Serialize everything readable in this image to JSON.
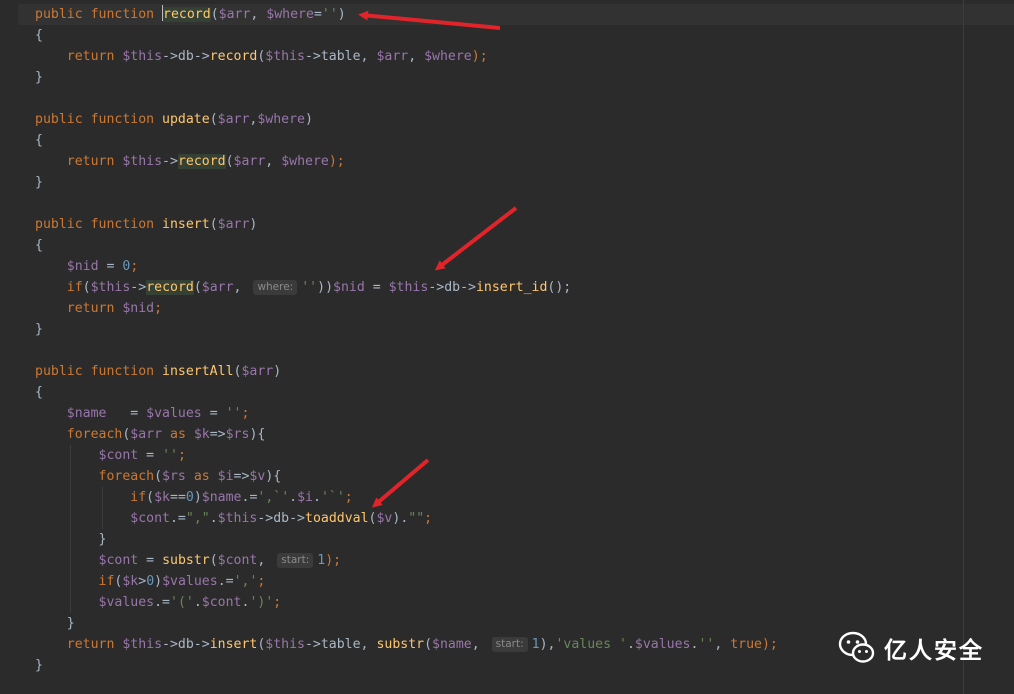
{
  "editor": {
    "lines": [
      [
        {
          "t": "public function ",
          "c": "kw"
        },
        {
          "t": "",
          "c": "caret"
        },
        {
          "t": "record",
          "c": "hl"
        },
        {
          "t": "(",
          "c": "plain"
        },
        {
          "t": "$arr",
          "c": "var"
        },
        {
          "t": ", ",
          "c": "plain"
        },
        {
          "t": "$where",
          "c": "var"
        },
        {
          "t": "=",
          "c": "plain"
        },
        {
          "t": "''",
          "c": "str"
        },
        {
          "t": ")",
          "c": "plain"
        }
      ],
      [
        {
          "t": "{",
          "c": "plain"
        }
      ],
      [
        {
          "t": "    return ",
          "c": "kw"
        },
        {
          "t": "$this",
          "c": "var"
        },
        {
          "t": "->db->",
          "c": "plain"
        },
        {
          "t": "record",
          "c": "fn"
        },
        {
          "t": "(",
          "c": "plain"
        },
        {
          "t": "$this",
          "c": "var"
        },
        {
          "t": "->table, ",
          "c": "plain"
        },
        {
          "t": "$arr",
          "c": "var"
        },
        {
          "t": ", ",
          "c": "plain"
        },
        {
          "t": "$where",
          "c": "var"
        },
        {
          "t": ");",
          "c": "kw"
        }
      ],
      [
        {
          "t": "}",
          "c": "plain"
        }
      ],
      [],
      [
        {
          "t": "public function ",
          "c": "kw"
        },
        {
          "t": "update",
          "c": "fn"
        },
        {
          "t": "(",
          "c": "plain"
        },
        {
          "t": "$arr",
          "c": "var"
        },
        {
          "t": ",",
          "c": "plain"
        },
        {
          "t": "$where",
          "c": "var"
        },
        {
          "t": ")",
          "c": "plain"
        }
      ],
      [
        {
          "t": "{",
          "c": "plain"
        }
      ],
      [
        {
          "t": "    return ",
          "c": "kw"
        },
        {
          "t": "$this",
          "c": "var"
        },
        {
          "t": "->",
          "c": "plain"
        },
        {
          "t": "record",
          "c": "hl"
        },
        {
          "t": "(",
          "c": "plain"
        },
        {
          "t": "$arr",
          "c": "var"
        },
        {
          "t": ", ",
          "c": "plain"
        },
        {
          "t": "$where",
          "c": "var"
        },
        {
          "t": ");",
          "c": "kw"
        }
      ],
      [
        {
          "t": "}",
          "c": "plain"
        }
      ],
      [],
      [
        {
          "t": "public function ",
          "c": "kw"
        },
        {
          "t": "insert",
          "c": "fn"
        },
        {
          "t": "(",
          "c": "plain"
        },
        {
          "t": "$arr",
          "c": "var"
        },
        {
          "t": ")",
          "c": "plain"
        }
      ],
      [
        {
          "t": "{",
          "c": "plain"
        }
      ],
      [
        {
          "t": "    ",
          "c": "plain"
        },
        {
          "t": "$nid",
          "c": "var"
        },
        {
          "t": " = ",
          "c": "plain"
        },
        {
          "t": "0",
          "c": "num"
        },
        {
          "t": ";",
          "c": "kw"
        }
      ],
      [
        {
          "t": "    if",
          "c": "kw"
        },
        {
          "t": "(",
          "c": "plain"
        },
        {
          "t": "$this",
          "c": "var"
        },
        {
          "t": "->",
          "c": "plain"
        },
        {
          "t": "record",
          "c": "hl"
        },
        {
          "t": "(",
          "c": "plain"
        },
        {
          "t": "$arr",
          "c": "var"
        },
        {
          "t": ", ",
          "c": "plain"
        },
        {
          "t": "where:",
          "c": "hint"
        },
        {
          "t": "''",
          "c": "str"
        },
        {
          "t": "))",
          "c": "plain"
        },
        {
          "t": "$nid",
          "c": "var"
        },
        {
          "t": " = ",
          "c": "plain"
        },
        {
          "t": "$this",
          "c": "var"
        },
        {
          "t": "->db->",
          "c": "plain"
        },
        {
          "t": "insert_id",
          "c": "fn"
        },
        {
          "t": "();",
          "c": "plain"
        }
      ],
      [
        {
          "t": "    return ",
          "c": "kw"
        },
        {
          "t": "$nid",
          "c": "var"
        },
        {
          "t": ";",
          "c": "kw"
        }
      ],
      [
        {
          "t": "}",
          "c": "plain"
        }
      ],
      [],
      [
        {
          "t": "public function ",
          "c": "kw"
        },
        {
          "t": "insertAll",
          "c": "fn"
        },
        {
          "t": "(",
          "c": "plain"
        },
        {
          "t": "$arr",
          "c": "var"
        },
        {
          "t": ")",
          "c": "plain"
        }
      ],
      [
        {
          "t": "{",
          "c": "plain"
        }
      ],
      [
        {
          "t": "    ",
          "c": "plain"
        },
        {
          "t": "$name",
          "c": "var"
        },
        {
          "t": "   = ",
          "c": "plain"
        },
        {
          "t": "$values",
          "c": "var"
        },
        {
          "t": " = ",
          "c": "plain"
        },
        {
          "t": "''",
          "c": "str"
        },
        {
          "t": ";",
          "c": "kw"
        }
      ],
      [
        {
          "t": "    foreach",
          "c": "kw"
        },
        {
          "t": "(",
          "c": "plain"
        },
        {
          "t": "$arr",
          "c": "var"
        },
        {
          "t": " as ",
          "c": "kw"
        },
        {
          "t": "$k",
          "c": "var"
        },
        {
          "t": "=>",
          "c": "plain"
        },
        {
          "t": "$rs",
          "c": "var"
        },
        {
          "t": "){",
          "c": "plain"
        }
      ],
      [
        {
          "t": "        ",
          "c": "plain"
        },
        {
          "t": "$cont",
          "c": "var"
        },
        {
          "t": " = ",
          "c": "plain"
        },
        {
          "t": "''",
          "c": "str"
        },
        {
          "t": ";",
          "c": "kw"
        }
      ],
      [
        {
          "t": "        foreach",
          "c": "kw"
        },
        {
          "t": "(",
          "c": "plain"
        },
        {
          "t": "$rs",
          "c": "var"
        },
        {
          "t": " as ",
          "c": "kw"
        },
        {
          "t": "$i",
          "c": "var"
        },
        {
          "t": "=>",
          "c": "plain"
        },
        {
          "t": "$v",
          "c": "var"
        },
        {
          "t": "){",
          "c": "plain"
        }
      ],
      [
        {
          "t": "            if",
          "c": "kw"
        },
        {
          "t": "(",
          "c": "plain"
        },
        {
          "t": "$k",
          "c": "var"
        },
        {
          "t": "==",
          "c": "plain"
        },
        {
          "t": "0",
          "c": "num"
        },
        {
          "t": ")",
          "c": "plain"
        },
        {
          "t": "$name",
          "c": "var"
        },
        {
          "t": ".=",
          "c": "plain"
        },
        {
          "t": "',`'",
          "c": "str"
        },
        {
          "t": ".",
          "c": "plain"
        },
        {
          "t": "$i",
          "c": "var"
        },
        {
          "t": ".",
          "c": "plain"
        },
        {
          "t": "'`'",
          "c": "str"
        },
        {
          "t": ";",
          "c": "kw"
        }
      ],
      [
        {
          "t": "            ",
          "c": "plain"
        },
        {
          "t": "$cont",
          "c": "var"
        },
        {
          "t": ".=",
          "c": "plain"
        },
        {
          "t": "\",\"",
          "c": "str"
        },
        {
          "t": ".",
          "c": "plain"
        },
        {
          "t": "$this",
          "c": "var"
        },
        {
          "t": "->db->",
          "c": "plain"
        },
        {
          "t": "toaddval",
          "c": "fn"
        },
        {
          "t": "(",
          "c": "plain"
        },
        {
          "t": "$v",
          "c": "var"
        },
        {
          "t": ").",
          "c": "plain"
        },
        {
          "t": "\"\"",
          "c": "str"
        },
        {
          "t": ";",
          "c": "kw"
        }
      ],
      [
        {
          "t": "        }",
          "c": "plain"
        }
      ],
      [
        {
          "t": "        ",
          "c": "plain"
        },
        {
          "t": "$cont",
          "c": "var"
        },
        {
          "t": " = ",
          "c": "plain"
        },
        {
          "t": "substr",
          "c": "fn"
        },
        {
          "t": "(",
          "c": "plain"
        },
        {
          "t": "$cont",
          "c": "var"
        },
        {
          "t": ", ",
          "c": "plain"
        },
        {
          "t": "start:",
          "c": "hint"
        },
        {
          "t": "1",
          "c": "num"
        },
        {
          "t": ");",
          "c": "kw"
        }
      ],
      [
        {
          "t": "        if",
          "c": "kw"
        },
        {
          "t": "(",
          "c": "plain"
        },
        {
          "t": "$k",
          "c": "var"
        },
        {
          "t": ">",
          "c": "plain"
        },
        {
          "t": "0",
          "c": "num"
        },
        {
          "t": ")",
          "c": "plain"
        },
        {
          "t": "$values",
          "c": "var"
        },
        {
          "t": ".=",
          "c": "plain"
        },
        {
          "t": "','",
          "c": "str"
        },
        {
          "t": ";",
          "c": "kw"
        }
      ],
      [
        {
          "t": "        ",
          "c": "plain"
        },
        {
          "t": "$values",
          "c": "var"
        },
        {
          "t": ".=",
          "c": "plain"
        },
        {
          "t": "'('",
          "c": "str"
        },
        {
          "t": ".",
          "c": "plain"
        },
        {
          "t": "$cont",
          "c": "var"
        },
        {
          "t": ".",
          "c": "plain"
        },
        {
          "t": "')'",
          "c": "str"
        },
        {
          "t": ";",
          "c": "kw"
        }
      ],
      [
        {
          "t": "    }",
          "c": "plain"
        }
      ],
      [
        {
          "t": "    return ",
          "c": "kw"
        },
        {
          "t": "$this",
          "c": "var"
        },
        {
          "t": "->db->",
          "c": "plain"
        },
        {
          "t": "insert",
          "c": "fn"
        },
        {
          "t": "(",
          "c": "plain"
        },
        {
          "t": "$this",
          "c": "var"
        },
        {
          "t": "->table, ",
          "c": "plain"
        },
        {
          "t": "substr",
          "c": "fn"
        },
        {
          "t": "(",
          "c": "plain"
        },
        {
          "t": "$name",
          "c": "var"
        },
        {
          "t": ", ",
          "c": "plain"
        },
        {
          "t": "start:",
          "c": "hint"
        },
        {
          "t": "1",
          "c": "num"
        },
        {
          "t": "),",
          "c": "plain"
        },
        {
          "t": "'values '",
          "c": "str"
        },
        {
          "t": ".",
          "c": "plain"
        },
        {
          "t": "$values",
          "c": "var"
        },
        {
          "t": ".",
          "c": "plain"
        },
        {
          "t": "''",
          "c": "str"
        },
        {
          "t": ", ",
          "c": "plain"
        },
        {
          "t": "true",
          "c": "kw"
        },
        {
          "t": ");",
          "c": "kw"
        }
      ],
      [
        {
          "t": "}",
          "c": "plain"
        }
      ]
    ]
  },
  "annotations": {
    "arrow_color": "#e0242a"
  },
  "watermark": {
    "icon": "wechat-icon",
    "text": "亿人安全"
  }
}
